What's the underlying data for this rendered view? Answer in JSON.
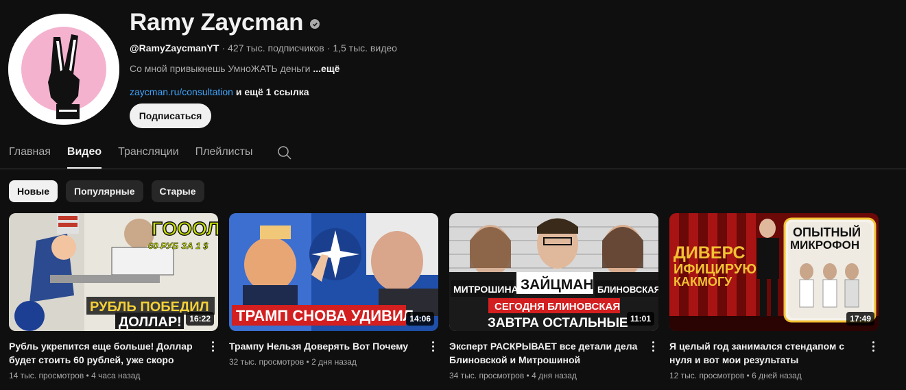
{
  "channel": {
    "name": "Ramy Zaycman",
    "handle": "@RamyZaycmanYT",
    "subscribers": "427 тыс. подписчиков",
    "videos_count": "1,5 тыс. видео",
    "description": "Со мной привыкнешь УмноЖАТЬ деньги",
    "description_more": "...ещё",
    "link": "zaycman.ru/consultation",
    "link_more": "и ещё 1 ссылка",
    "subscribe_label": "Подписаться"
  },
  "tabs": [
    {
      "label": "Главная"
    },
    {
      "label": "Видео"
    },
    {
      "label": "Трансляции"
    },
    {
      "label": "Плейлисты"
    }
  ],
  "chips": [
    {
      "label": "Новые"
    },
    {
      "label": "Популярные"
    },
    {
      "label": "Старые"
    }
  ],
  "videos": [
    {
      "title": "Рубль укрепится еще больше! Доллар будет стоить 60 рублей, уже скоро",
      "views": "14 тыс. просмотров",
      "age": "4 часа назад",
      "duration": "16:22",
      "thumb_text": [
        "ГОООЛ",
        "60 РУБ ЗА 1 $",
        "РУБЛЬ ПОБЕДИЛ",
        "ДОЛЛАР!"
      ]
    },
    {
      "title": "Трампу Нельзя Доверять Вот Почему",
      "views": "32 тыс. просмотров",
      "age": "2 дня назад",
      "duration": "14:06",
      "thumb_text": [
        "ТРАМП СНОВА УДИВИЛ"
      ]
    },
    {
      "title": "Эксперт РАСКРЫВАЕТ все детали дела Блиновской и Митрошиной",
      "views": "34 тыс. просмотров",
      "age": "4 дня назад",
      "duration": "11:01",
      "thumb_text": [
        "МИТРОШИНА",
        "ЗАЙЦМАН",
        "БЛИНОВСКАЯ",
        "СЕГОДНЯ БЛИНОВСКАЯ",
        "ЗАВТРА ОСТАЛЬНЫЕ"
      ]
    },
    {
      "title": "Я целый год занимался стендапом с нуля и вот мои результаты",
      "views": "12 тыс. просмотров",
      "age": "6 дней назад",
      "duration": "17:49",
      "thumb_text": [
        "ДИВЕРС",
        "ИФИЦИРУЮ",
        "КАКМОГУ",
        "ОПЫТНЫЙ",
        "МИКРОФОН"
      ]
    }
  ]
}
